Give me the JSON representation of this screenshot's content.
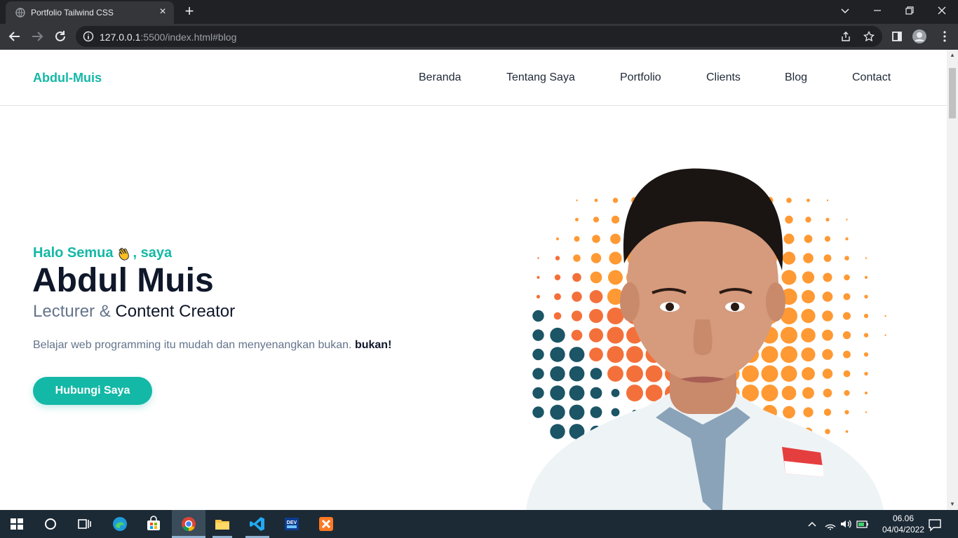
{
  "browser": {
    "tab_title": "Portfolio Tailwind CSS",
    "url_host": "127.0.0.1",
    "url_rest": ":5500/index.html#blog"
  },
  "site": {
    "brand": "Abdul-Muis",
    "nav": [
      "Beranda",
      "Tentang Saya",
      "Portfolio",
      "Clients",
      "Blog",
      "Contact"
    ]
  },
  "hero": {
    "greeting_before": "Halo Semua",
    "greeting_emoji_icon": "waving-hand-icon",
    "greeting_after": ", saya",
    "name": "Abdul Muis",
    "role_prefix": "Lecturer &",
    "role_suffix": "Content Creator",
    "tagline_text": "Belajar web programming itu mudah dan menyenangkan bukan.",
    "tagline_bold": "bukan!",
    "cta_label": "Hubungi Saya"
  },
  "taskbar": {
    "time": "06.06",
    "date": "04/04/2022"
  },
  "colors": {
    "accent": "#14b8a6",
    "dark": "#0f172a",
    "muted": "#64748b",
    "orange": "#ff9933",
    "orange_deep": "#f4703a",
    "teal_dark": "#1b5566"
  }
}
